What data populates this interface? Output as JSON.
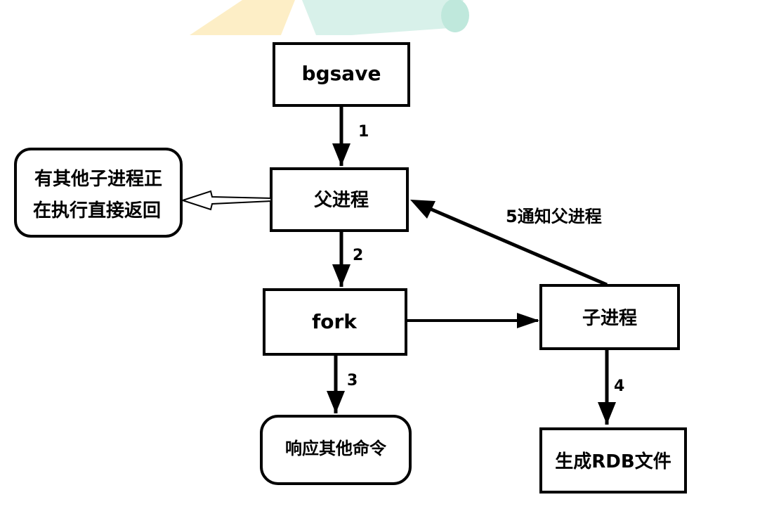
{
  "diagram": {
    "nodes": {
      "bgsave": "bgsave",
      "parent": "父进程",
      "busy_line1": "有其他子进程正",
      "busy_line2": "在执行直接返回",
      "fork": "fork",
      "child": "子进程",
      "respond": "响应其他命令",
      "rdb": "生成RDB文件"
    },
    "edges": {
      "step1": "1",
      "step2": "2",
      "step3": "3",
      "step4": "4",
      "step5": "5通知父进程"
    }
  },
  "colors": {
    "stroke": "#000000",
    "banner_yellow": "#fdeec6",
    "banner_teal": "#d8f1ea",
    "banner_teal_dark": "#bfe8dc"
  }
}
